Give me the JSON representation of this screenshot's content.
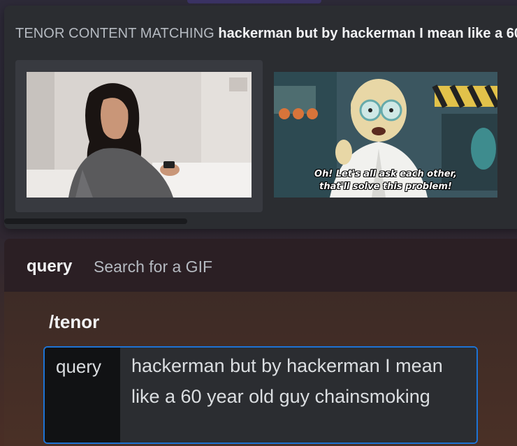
{
  "popup": {
    "header_label": "TENOR CONTENT MATCHING",
    "search_term": "hackerman but by hackerman I mean like a 60 year old guy chainsmoking",
    "gifs": [
      {
        "icon": "gif-thumbnail-woman-typing-phone"
      },
      {
        "icon": "gif-thumbnail-professor-farnsworth",
        "caption": "Oh! Let's all ask each other,\nthat'll solve this problem!"
      }
    ]
  },
  "option": {
    "name": "query",
    "description": "Search for a GIF"
  },
  "command": {
    "name": "/tenor",
    "param_label": "query",
    "param_value": "hackerman but by hackerman I mean like a 60 year old guy chainsmoking"
  },
  "colors": {
    "accent_border": "#1d73d4",
    "popup_bg": "#2b2d31"
  }
}
